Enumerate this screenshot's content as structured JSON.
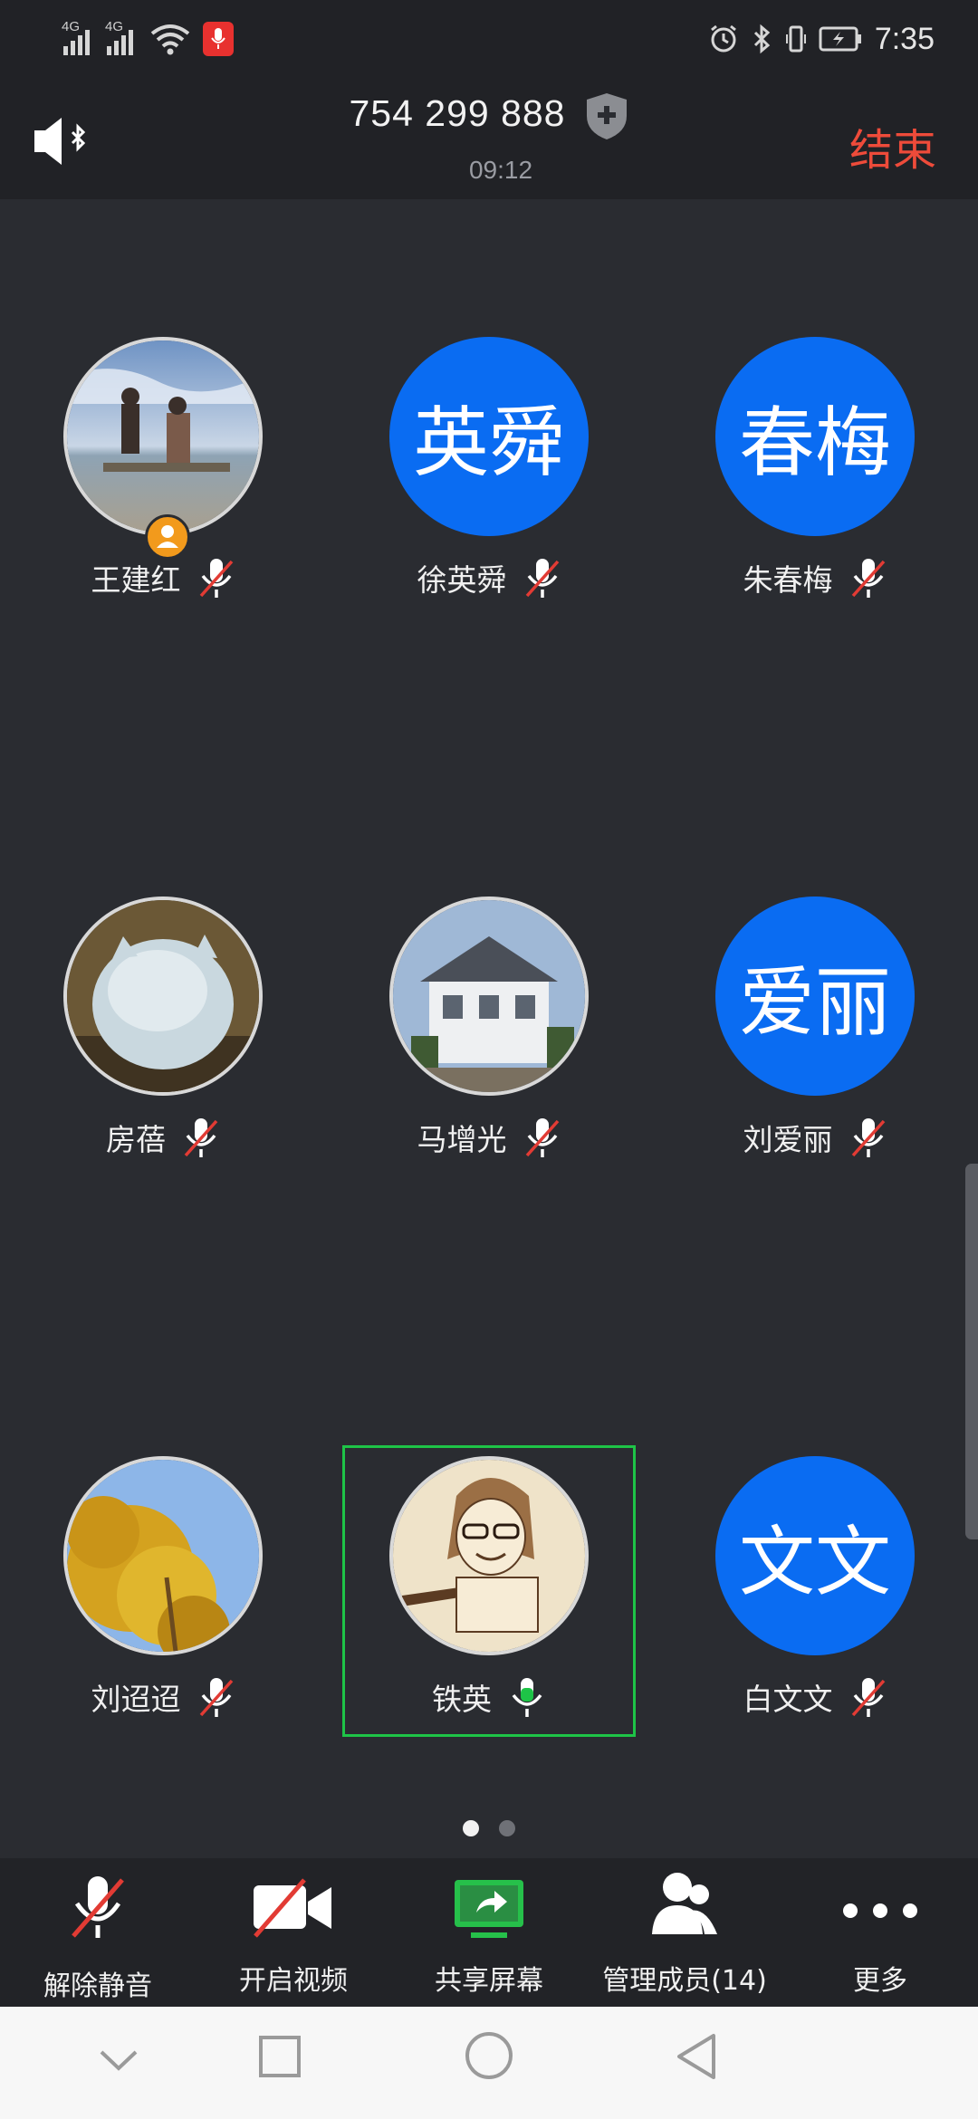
{
  "status_bar": {
    "network_1": "4G",
    "network_2": "4G",
    "time": "7:35"
  },
  "header": {
    "meeting_id": "754 299 888",
    "duration": "09:12",
    "end_label": "结束"
  },
  "participants": [
    {
      "name": "王建红",
      "avatar_text": "",
      "avatar_type": "photo",
      "muted": true,
      "host": true
    },
    {
      "name": "徐英舜",
      "avatar_text": "英舜",
      "avatar_type": "initials",
      "muted": true
    },
    {
      "name": "朱春梅",
      "avatar_text": "春梅",
      "avatar_type": "initials",
      "muted": true
    },
    {
      "name": "房蓓",
      "avatar_text": "",
      "avatar_type": "photo",
      "muted": true
    },
    {
      "name": "马增光",
      "avatar_text": "",
      "avatar_type": "photo",
      "muted": true
    },
    {
      "name": "刘爱丽",
      "avatar_text": "爱丽",
      "avatar_type": "initials",
      "muted": true
    },
    {
      "name": "刘迢迢",
      "avatar_text": "",
      "avatar_type": "photo",
      "muted": true
    },
    {
      "name": "铁英",
      "avatar_text": "",
      "avatar_type": "photo",
      "muted": false,
      "speaking": true
    },
    {
      "name": "白文文",
      "avatar_text": "文文",
      "avatar_type": "initials",
      "muted": true
    }
  ],
  "pagination": {
    "pages": 2,
    "current": 1
  },
  "toolbar": {
    "unmute": "解除静音",
    "video": "开启视频",
    "share": "共享屏幕",
    "members": "管理成员(14)",
    "more": "更多"
  },
  "colors": {
    "accent_blue": "#0a6cf2",
    "end_red": "#ee4b3a",
    "speaking_green": "#1ec447",
    "share_green": "#26c04a",
    "host_orange": "#f29a1c"
  },
  "icons": {
    "speaker": "speaker-bluetooth-icon",
    "shield": "shield-plus-icon",
    "mic_muted": "mic-off-icon",
    "mic_on": "mic-on-icon",
    "video_off": "video-off-icon",
    "share": "share-screen-icon",
    "members": "members-icon",
    "more": "more-dots-icon"
  }
}
